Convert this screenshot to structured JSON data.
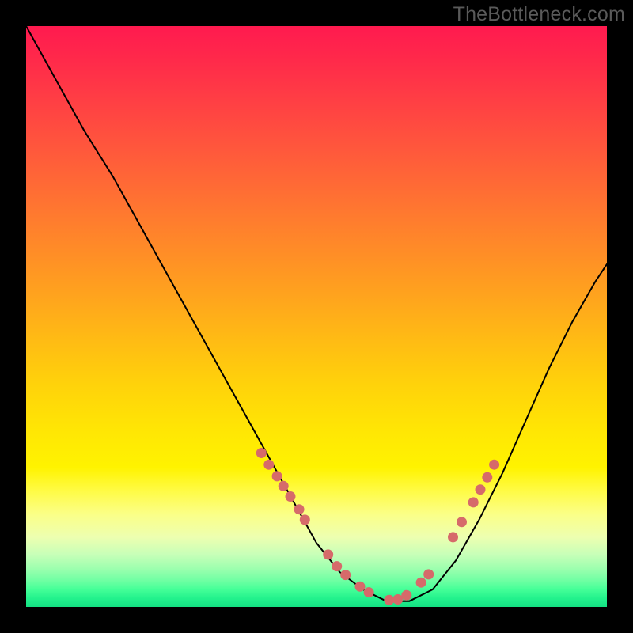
{
  "watermark": "TheBottleneck.com",
  "chart_data": {
    "type": "line",
    "title": "",
    "xlabel": "",
    "ylabel": "",
    "xlim": [
      0,
      100
    ],
    "ylim": [
      0,
      100
    ],
    "grid": false,
    "legend": false,
    "series": [
      {
        "name": "bottleneck-curve",
        "x": [
          0,
          5,
          10,
          15,
          20,
          25,
          30,
          35,
          40,
          45,
          50,
          54,
          58,
          62,
          66,
          70,
          74,
          78,
          82,
          86,
          90,
          94,
          98,
          100
        ],
        "y": [
          100,
          91,
          82,
          74,
          65,
          56,
          47,
          38,
          29,
          20,
          11,
          6,
          3,
          1,
          1,
          3,
          8,
          15,
          23,
          32,
          41,
          49,
          56,
          59
        ]
      }
    ],
    "markers": {
      "name": "highlighted-points",
      "color": "#d66a6a",
      "x": [
        40.5,
        41.8,
        43.2,
        44.3,
        45.5,
        47.0,
        48.0,
        52.0,
        53.5,
        55.0,
        57.5,
        59.0,
        62.5,
        64.0,
        65.5,
        68.0,
        69.3,
        73.5,
        75.0,
        77.0,
        78.2,
        79.4,
        80.6
      ],
      "y": [
        26.5,
        24.5,
        22.5,
        20.8,
        19.0,
        16.8,
        15.0,
        9.0,
        7.0,
        5.5,
        3.5,
        2.5,
        1.2,
        1.3,
        2.0,
        4.2,
        5.6,
        12.0,
        14.6,
        18.0,
        20.2,
        22.3,
        24.5
      ]
    },
    "background_gradient": {
      "top": "#ff1a4f",
      "mid": "#ffe704",
      "bottom": "#14e183"
    }
  }
}
